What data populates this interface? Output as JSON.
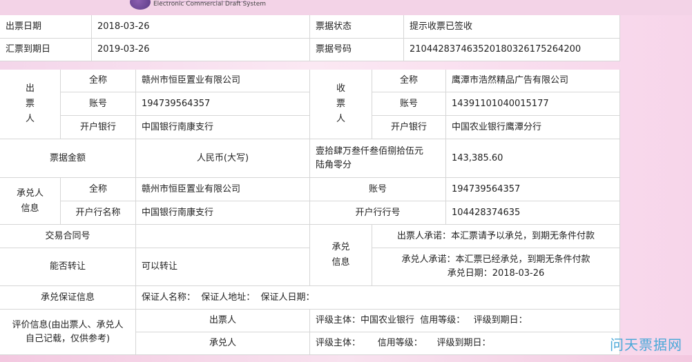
{
  "header": {
    "logo_text": "Electronic Commercial Draft System"
  },
  "top": {
    "issue_date_label": "出票日期",
    "issue_date": "2018-03-26",
    "status_label": "票据状态",
    "status": "提示收票已签收",
    "due_date_label": "汇票到期日",
    "due_date": "2019-03-26",
    "number_label": "票据号码",
    "number": "210442837463520180326175264200"
  },
  "drawer": {
    "side_label": [
      "出",
      "票",
      "人"
    ],
    "name_label": "全称",
    "name": "赣州市恒臣置业有限公司",
    "account_label": "账号",
    "account": "194739564357",
    "bank_label": "开户银行",
    "bank": "中国银行南康支行"
  },
  "payee": {
    "side_label": [
      "收",
      "票",
      "人"
    ],
    "name_label": "全称",
    "name": "鹰潭市浩然精品广告有限公司",
    "account_label": "账号",
    "account": "14391101040015177",
    "bank_label": "开户银行",
    "bank": "中国农业银行鹰潭分行"
  },
  "amount": {
    "label": "票据金额",
    "currency_label": "人民币(大写)",
    "words_line1": "壹拾肆万叁仟叁佰捌拾伍元",
    "words_line2": "陆角零分",
    "figure": "143,385.60"
  },
  "acceptor": {
    "side_label_1": "承兑人",
    "side_label_2": "信息",
    "name_label": "全称",
    "name": "赣州市恒臣置业有限公司",
    "account_label": "账号",
    "account": "194739564357",
    "bank_label": "开户行名称",
    "bank": "中国银行南康支行",
    "bank_no_label": "开户行行号",
    "bank_no": "104428374635"
  },
  "contract": {
    "label": "交易合同号",
    "value": ""
  },
  "transfer": {
    "label": "能否转让",
    "value": "可以转让"
  },
  "acceptance_info": {
    "label_1": "承兑",
    "label_2": "信息",
    "drawer_promise": "出票人承诺：本汇票请予以承兑，到期无条件付款",
    "acceptor_promise": "承兑人承诺：本汇票已经承兑，到期无条件付款",
    "acceptance_date": "承兑日期：2018-03-26"
  },
  "guarantee": {
    "label": "承兑保证信息",
    "value": "保证人名称：  保证人地址：  保证人日期："
  },
  "rating": {
    "label_line1": "评价信息(由出票人、承兑人",
    "label_line2": "自己记载，仅供参考)",
    "drawer_label": "出票人",
    "drawer_value": "评级主体：中国农业银行  信用等级：   评级到期日：",
    "acceptor_label": "承兑人",
    "acceptor_value": "评级主体：      信用等级：     评级到期日："
  },
  "watermark": "问天票据网"
}
